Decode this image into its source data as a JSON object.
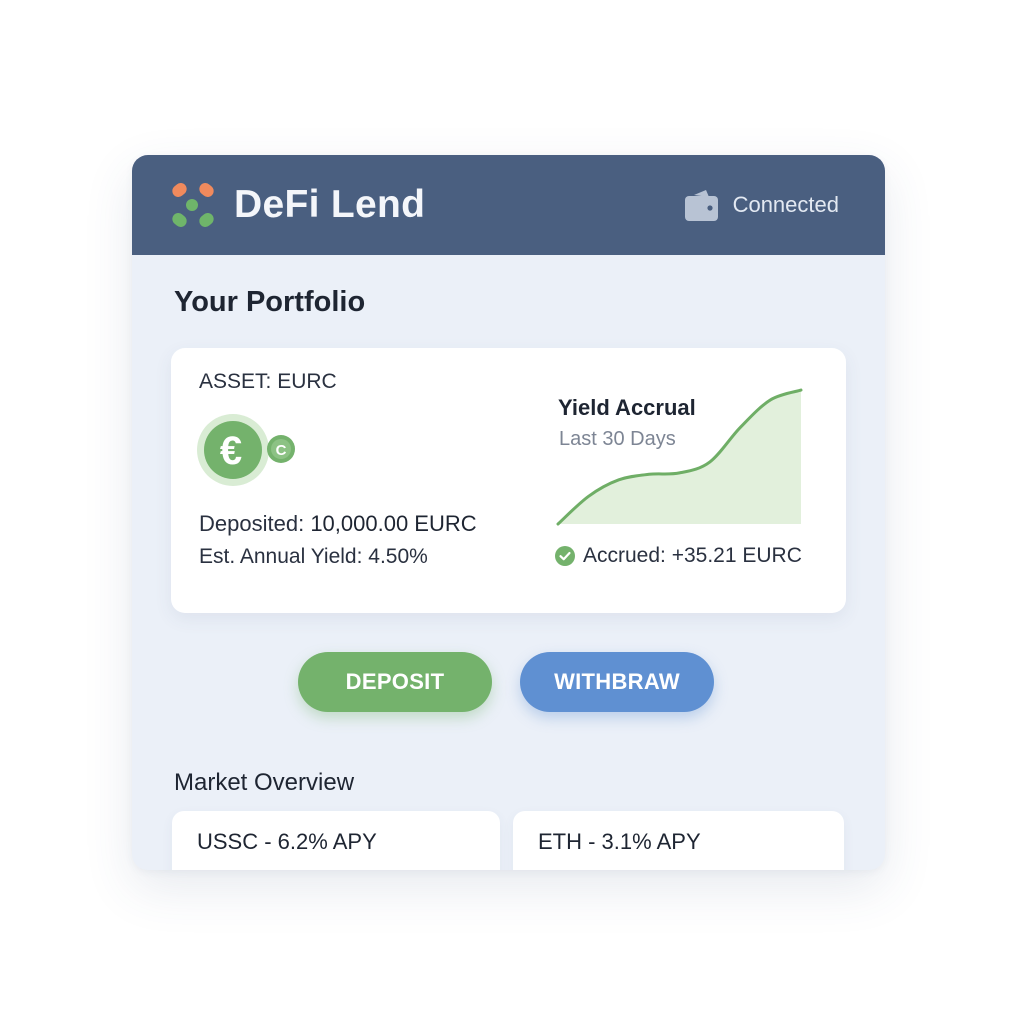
{
  "header": {
    "app_title": "DeFi Lend",
    "logo_icon": "lend-logo-icon",
    "wallet_icon": "wallet-icon",
    "wallet_status": "Connected"
  },
  "portfolio": {
    "heading": "Your Portfolio",
    "asset_label": "ASSET: EURC",
    "coin_icon": "euro-coin-icon",
    "coin_symbol": "€",
    "coin_badge": "C",
    "deposited_label": "Deposited:",
    "deposited_value": "10,000.00 EURC",
    "yield_label": "Est. Annual Yield:",
    "yield_value": "4.50%",
    "chart": {
      "title": "Yield Accrual",
      "subtitle": "Last 30 Days",
      "accrued_text": "Accrued: +35.21 EURC",
      "accrued_icon": "check-circle-icon"
    }
  },
  "actions": {
    "deposit_label": "DEPOSIT",
    "withdraw_label": "WITHBRAW"
  },
  "market": {
    "heading": "Market Overview",
    "items": [
      {
        "text": "USSC - 6.2% APY"
      },
      {
        "text": "ETH - 3.1% APY"
      }
    ]
  },
  "colors": {
    "header_bg": "#4a5f80",
    "body_bg": "#ebf0f8",
    "accent_green": "#74b26c",
    "accent_blue": "#5f90d2",
    "chart_fill": "#e2f0dc",
    "chart_line": "#6fae66",
    "logo_orange": "#f08a5d",
    "logo_green": "#6fb56a"
  },
  "chart_data": {
    "type": "area",
    "title": "Yield Accrual",
    "subtitle": "Last 30 Days",
    "x": [
      0,
      1,
      2,
      3,
      4,
      5,
      6,
      7,
      8
    ],
    "values": [
      0.0,
      0.2,
      0.32,
      0.36,
      0.37,
      0.45,
      0.7,
      0.9,
      0.97
    ],
    "ylim": [
      0,
      1
    ],
    "grid": false
  }
}
